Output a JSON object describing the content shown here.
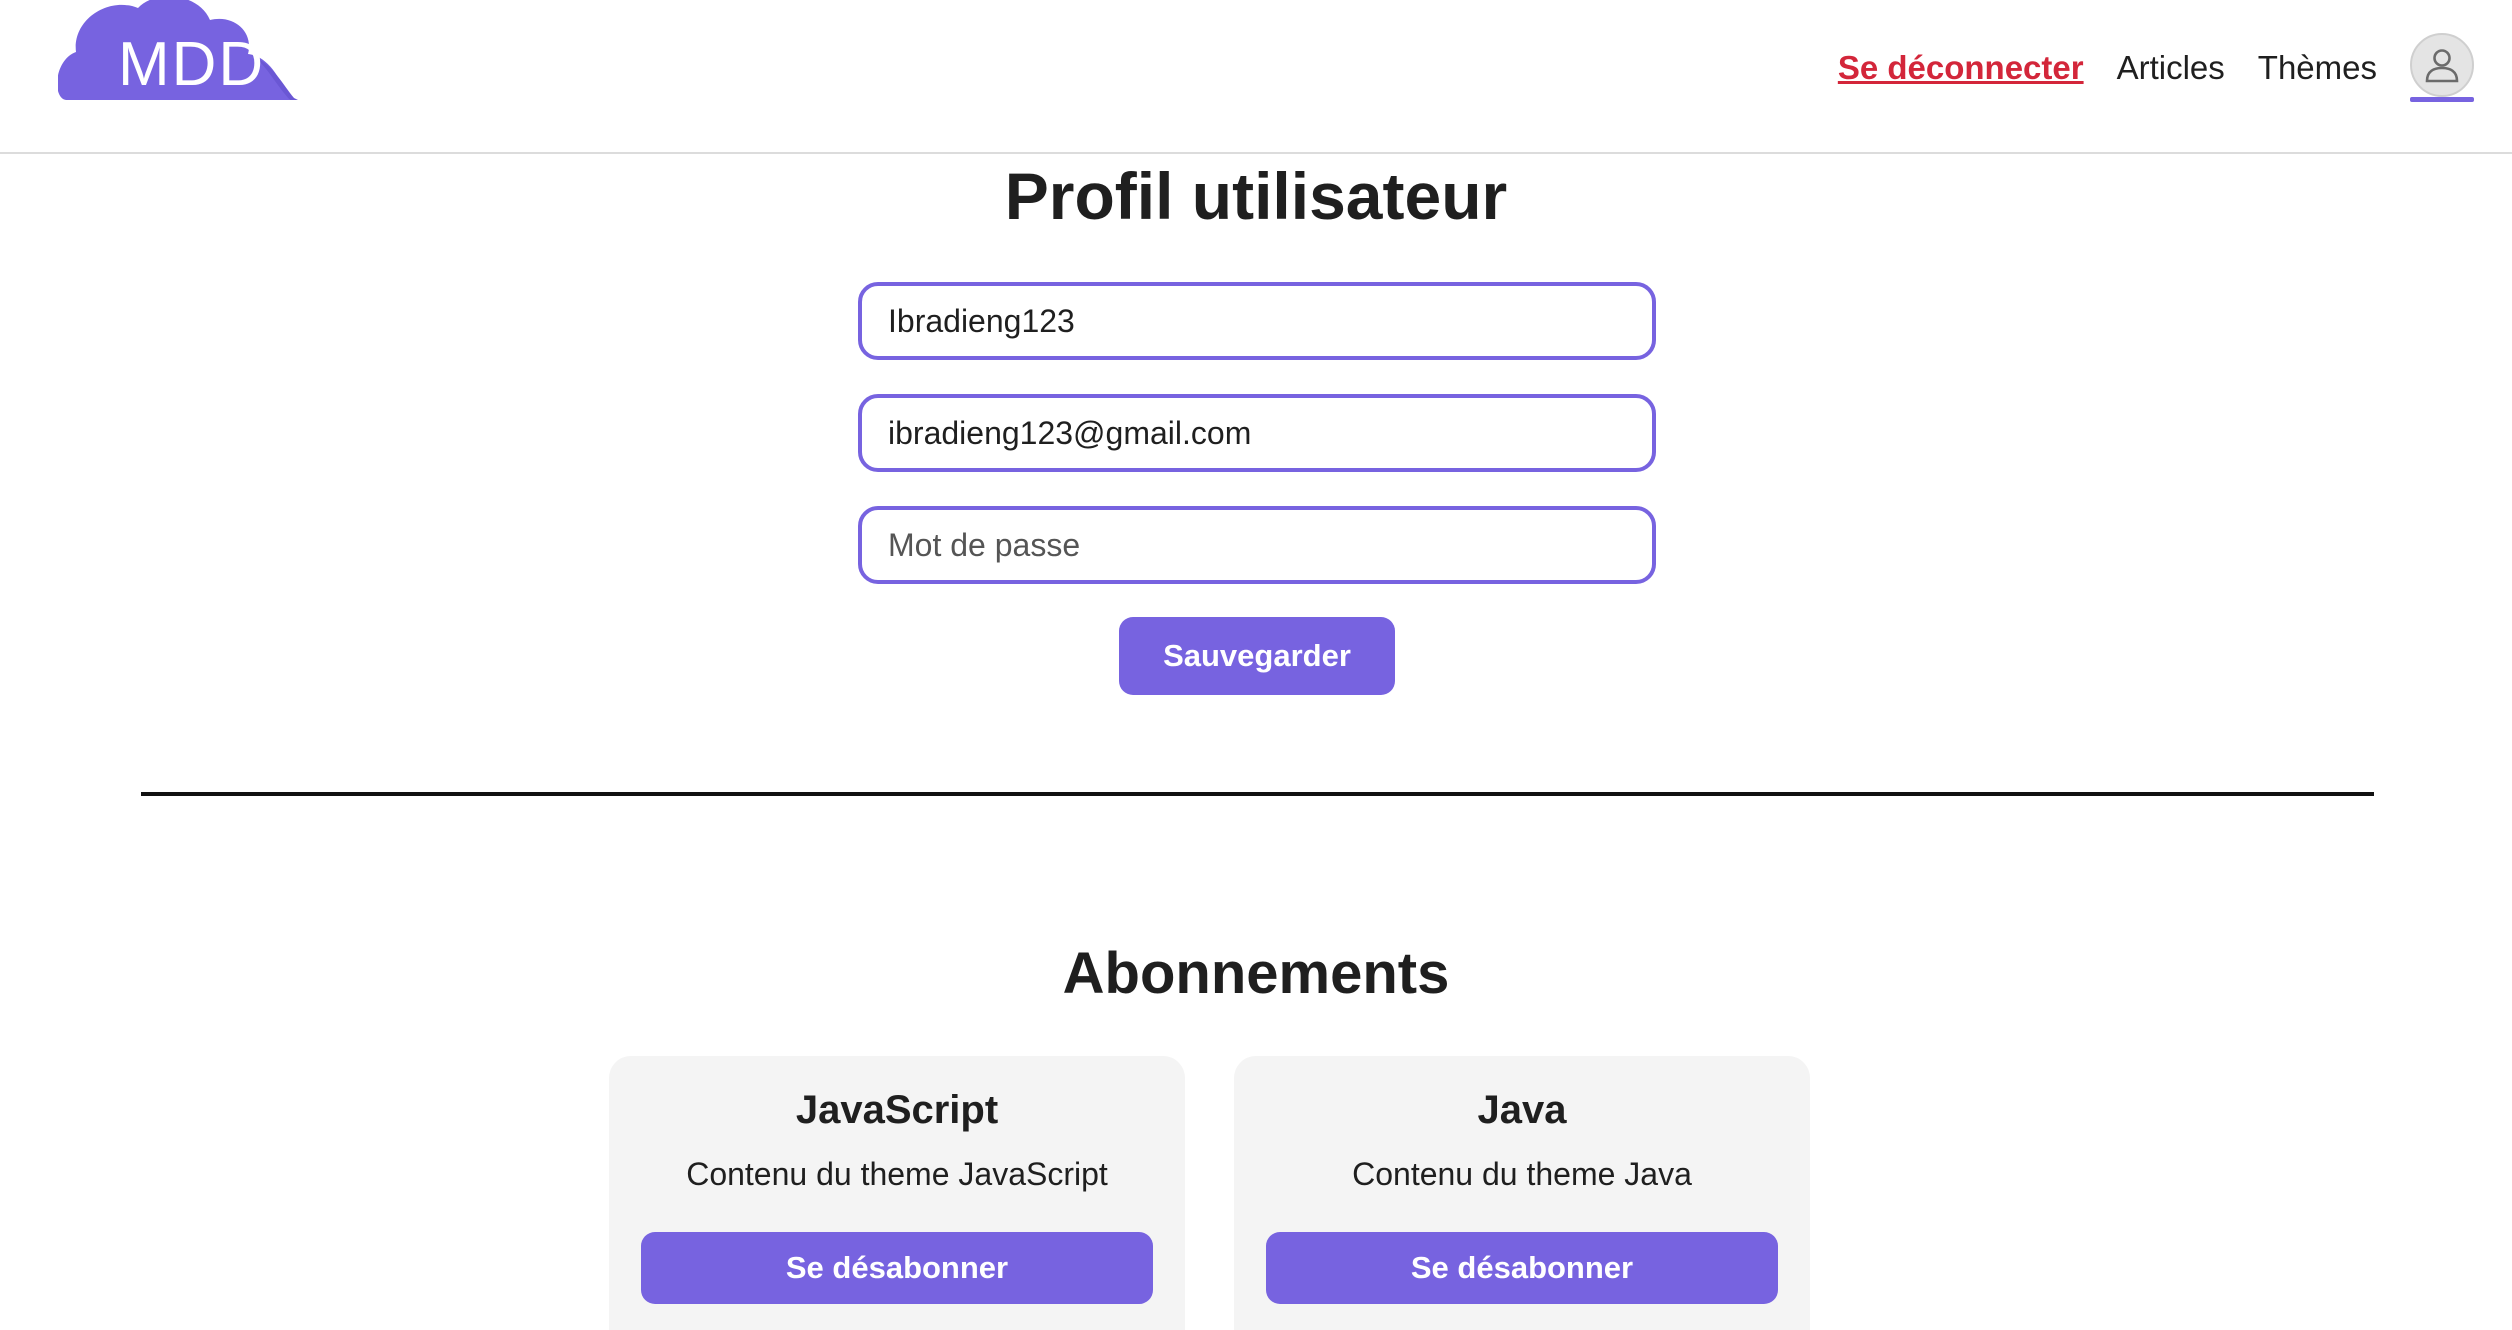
{
  "header": {
    "logo_text": "MDD",
    "nav": {
      "logout_label": "Se déconnecter",
      "articles_label": "Articles",
      "themes_label": "Thèmes"
    }
  },
  "profile": {
    "title": "Profil utilisateur",
    "username_value": "Ibradieng123",
    "email_value": "ibradieng123@gmail.com",
    "password_placeholder": "Mot de passe",
    "save_label": "Sauvegarder"
  },
  "subscriptions": {
    "title": "Abonnements",
    "items": [
      {
        "name": "JavaScript",
        "description": "Contenu du theme JavaScript",
        "button_label": "Se désabonner"
      },
      {
        "name": "Java",
        "description": "Contenu du theme Java",
        "button_label": "Se désabonner"
      }
    ]
  },
  "colors": {
    "accent": "#7763e0",
    "logout": "#d3263a",
    "card_bg": "#f4f4f4"
  }
}
